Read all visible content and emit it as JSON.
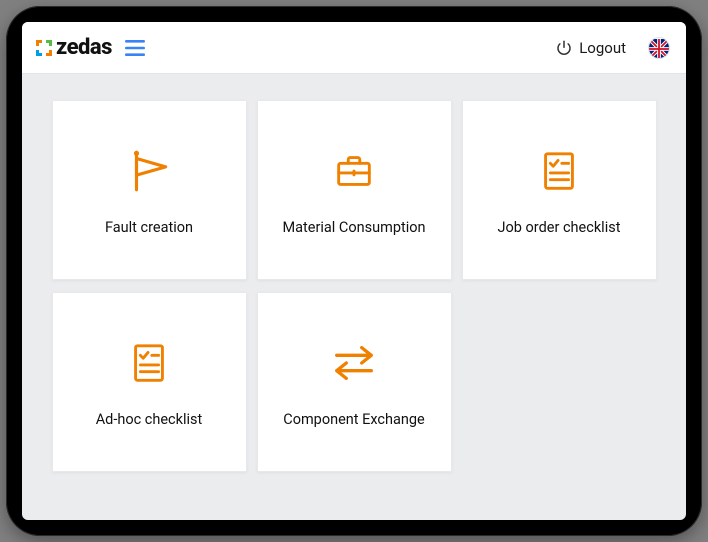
{
  "brand": {
    "name": "zedas"
  },
  "header": {
    "menu_icon": "menu",
    "logout_label": "Logout",
    "language": "en-GB"
  },
  "tiles": [
    {
      "icon": "flag",
      "label": "Fault creation"
    },
    {
      "icon": "briefcase",
      "label": "Material Consumption"
    },
    {
      "icon": "checklist",
      "label": "Job order checklist"
    },
    {
      "icon": "checklist",
      "label": "Ad-hoc checklist"
    },
    {
      "icon": "swap",
      "label": "Component Exchange"
    }
  ],
  "accent_color": "#f08000"
}
